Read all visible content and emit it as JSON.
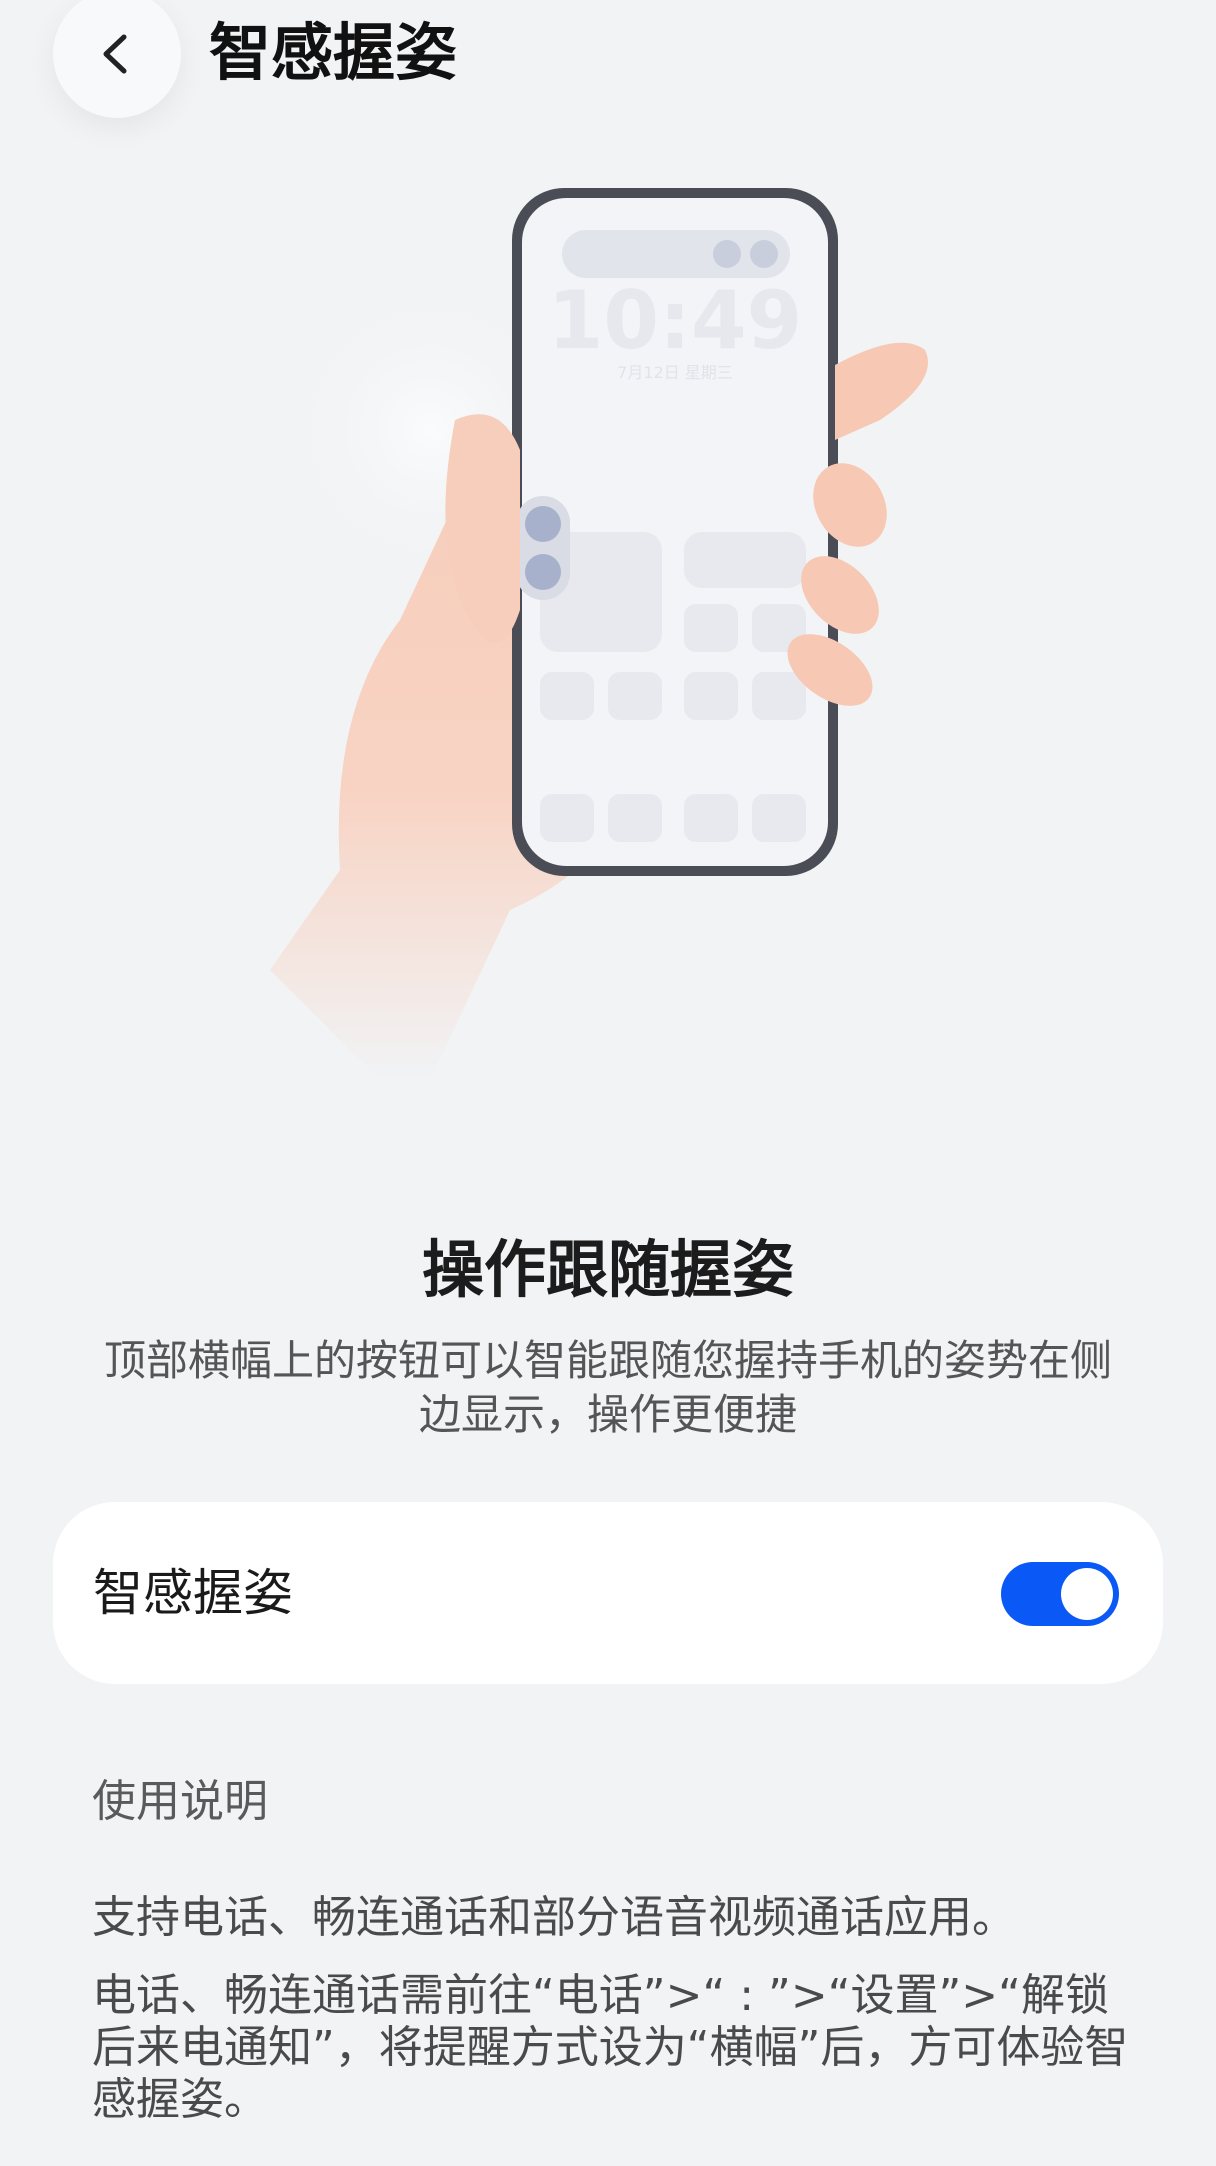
{
  "header": {
    "title": "智感握姿",
    "back_icon": "chevron-left-icon"
  },
  "illustration": {
    "clock_time": "10:49",
    "clock_date": "7月12日 星期三"
  },
  "feature": {
    "heading": "操作跟随握姿",
    "description": "顶部横幅上的按钮可以智能跟随您握持手机的姿势在侧边显示，操作更便捷"
  },
  "setting": {
    "label": "智感握姿",
    "toggle_on": true,
    "toggle_color": "#0a59f7"
  },
  "usage": {
    "title": "使用说明",
    "p1": "支持电话、畅连通话和部分语音视频通话应用。",
    "p2": "电话、畅连通话需前往“电话”>“ : ”>“设置”>“解锁后来电通知”，将提醒方式设为“横幅”后，方可体验智感握姿。"
  }
}
